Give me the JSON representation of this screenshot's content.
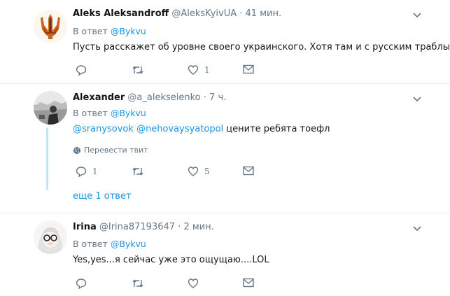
{
  "tweets": [
    {
      "name": "Aleks Aleksandroff",
      "handle": "@AleksKyivUA",
      "time": "· 41 мин.",
      "reply_prefix": "В ответ",
      "reply_to": "@Bykvu",
      "text": "Пусть расскажет об уровне своего украинского. Хотя там и с русским траблы",
      "reply_count": "",
      "retweet_count": "",
      "like_count": "1"
    },
    {
      "name": "Alexander",
      "handle": "@a_alekseienko",
      "time": "· 7 ч.",
      "reply_prefix": "В ответ",
      "reply_to": "@Bykvu",
      "mention1": "@sranysovok",
      "mention2": "@nehovaysyatopol",
      "text_rest": " цените ребята тоефл",
      "translate": "Перевести твит",
      "reply_count": "1",
      "retweet_count": "",
      "like_count": "5",
      "more_replies": "еще 1 ответ"
    },
    {
      "name": "Irina",
      "handle": "@Irina87193647",
      "time": "· 2 мин.",
      "reply_prefix": "В ответ",
      "reply_to": "@Bykvu",
      "text": "Yes,yes...я сейчас уже это ощущаю....LOL",
      "reply_count": "",
      "retweet_count": "",
      "like_count": ""
    }
  ],
  "icons": {
    "reply": "reply-icon",
    "retweet": "retweet-icon",
    "like": "heart-icon",
    "dm": "envelope-icon",
    "caret": "chevron-down-icon",
    "globe": "globe-icon"
  },
  "colors": {
    "link": "#1b95e0",
    "muted": "#657786",
    "thread_line": "#c4e4f7",
    "separator": "#e6ecf0"
  }
}
